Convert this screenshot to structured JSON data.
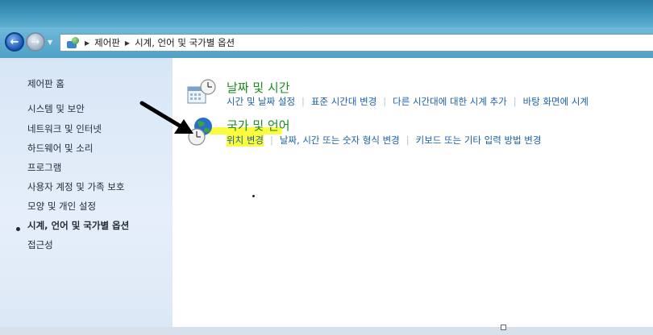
{
  "breadcrumb": {
    "root": "제어판",
    "current": "시계, 언어 및 국가별 옵션"
  },
  "sidebar": {
    "home": "제어판 홈",
    "items": [
      {
        "label": "시스템 및 보안"
      },
      {
        "label": "네트워크 및 인터넷"
      },
      {
        "label": "하드웨어 및 소리"
      },
      {
        "label": "프로그램"
      },
      {
        "label": "사용자 계정 및 가족 보호"
      },
      {
        "label": "모양 및 개인 설정"
      },
      {
        "label": "시계, 언어 및 국가별 옵션"
      },
      {
        "label": "접근성"
      }
    ]
  },
  "categories": [
    {
      "title": "날짜 및 시간",
      "icon": "calendar-clock-icon",
      "tasks": [
        "시간 및 날짜 설정",
        "표준 시간대 변경",
        "다른 시간대에 대한 시계 추가",
        "바탕 화면에 시계"
      ]
    },
    {
      "title": "국가 및 언어",
      "icon": "globe-clock-icon",
      "tasks": [
        "위치 변경",
        "날짜, 시간 또는 숫자 형식 변경",
        "키보드 또는 기타 입력 방법 변경"
      ]
    }
  ],
  "colors": {
    "title_green": "#1f8a22",
    "link_blue": "#1a5fa8",
    "highlight": "#fbfb3a",
    "sidebar_bg": "#dbe8f5"
  }
}
